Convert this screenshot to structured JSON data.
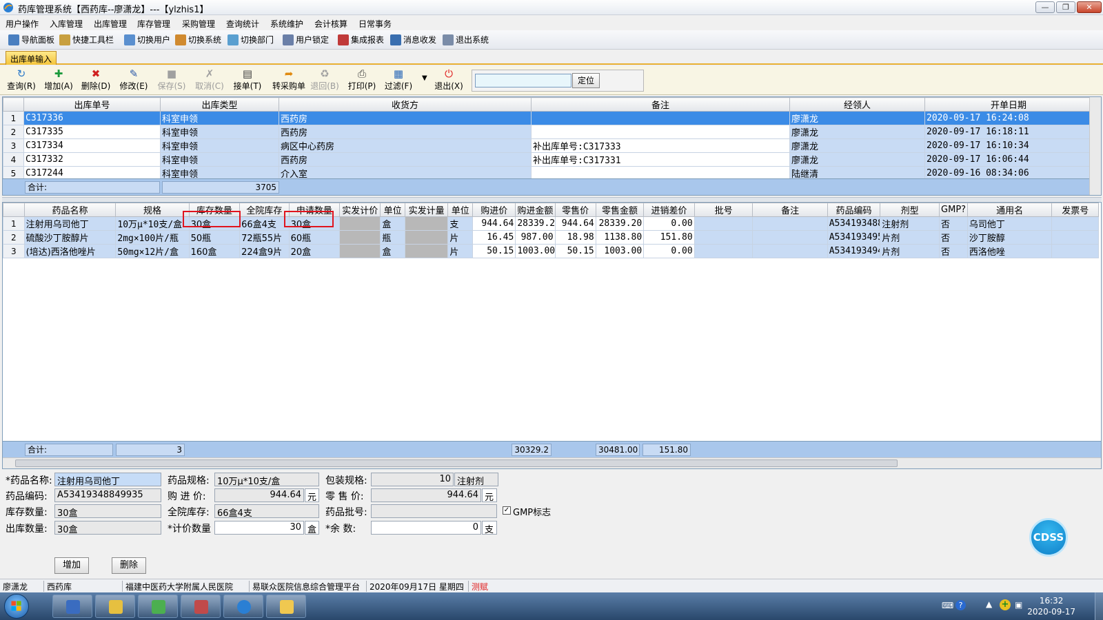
{
  "window": {
    "title": "药库管理系统【西药库--廖潇龙】---【ylzhis1】",
    "minimize": "—",
    "restore": "❐",
    "close": "✕"
  },
  "menu": [
    "用户操作",
    "入库管理",
    "出库管理",
    "库存管理",
    "采购管理",
    "查询统计",
    "系统维护",
    "会计核算",
    "日常事务"
  ],
  "quickbar": [
    {
      "label": "导航面板",
      "icon": "nav-panel-icon",
      "color": "#4a7fc0"
    },
    {
      "label": "快捷工具栏",
      "icon": "tool-icon",
      "color": "#c8a040"
    },
    {
      "label": "切换用户",
      "icon": "users-icon",
      "color": "#5a8fcf"
    },
    {
      "label": "切换系统",
      "icon": "switch-icon",
      "color": "#d08a30"
    },
    {
      "label": "切换部门",
      "icon": "dept-icon",
      "color": "#5a9fd0"
    },
    {
      "label": "用户锁定",
      "icon": "lock-user-icon",
      "color": "#6a7fa8"
    },
    {
      "label": "集成报表",
      "icon": "report-icon",
      "color": "#c03a3a"
    },
    {
      "label": "消息收发",
      "icon": "help-icon",
      "color": "#3a6fb0"
    },
    {
      "label": "退出系统",
      "icon": "exit-icon",
      "color": "#7a8ca8"
    }
  ],
  "tab": "出库单输入",
  "actions": [
    {
      "label": "查询(R)",
      "icon": "query-icon",
      "glyph": "↻",
      "color": "#2a78c8",
      "disabled": false
    },
    {
      "label": "增加(A)",
      "icon": "add-icon",
      "glyph": "✚",
      "color": "#1c9a3c",
      "disabled": false
    },
    {
      "label": "删除(D)",
      "icon": "delete-icon",
      "glyph": "✖",
      "color": "#d02020",
      "disabled": false
    },
    {
      "label": "修改(E)",
      "icon": "edit-icon",
      "glyph": "✎",
      "color": "#2a58a8",
      "disabled": false
    },
    {
      "label": "保存(S)",
      "icon": "save-icon",
      "glyph": "■",
      "color": "#a0a0a0",
      "disabled": true
    },
    {
      "label": "取消(C)",
      "icon": "cancel-icon",
      "glyph": "✗",
      "color": "#a0a0a0",
      "disabled": true
    },
    {
      "label": "接单(T)",
      "icon": "receive-icon",
      "glyph": "▤",
      "color": "#404040",
      "disabled": false
    },
    {
      "label": "转采购单",
      "icon": "transfer-icon",
      "glyph": "➦",
      "color": "#e08a10",
      "disabled": false
    },
    {
      "label": "退回(B)",
      "icon": "return-icon",
      "glyph": "♻",
      "color": "#a0a0a0",
      "disabled": true
    },
    {
      "label": "打印(P)",
      "icon": "print-icon",
      "glyph": "⎙",
      "color": "#404040",
      "disabled": false
    },
    {
      "label": "过滤(F)",
      "icon": "filter-icon",
      "glyph": "▦",
      "color": "#2a68b8",
      "disabled": false
    },
    {
      "label": "退出(X)",
      "icon": "power-icon",
      "glyph": "⏻",
      "color": "#e02020",
      "disabled": false
    }
  ],
  "locate": {
    "value": "",
    "button": "定位"
  },
  "orders": {
    "headers": [
      "出库单号",
      "出库类型",
      "收货方",
      "备注",
      "经领人",
      "开单日期"
    ],
    "rows": [
      {
        "no": "1",
        "cells": [
          "C317336",
          "科室申领",
          "西药房",
          "",
          "廖潇龙",
          "2020-09-17 16:24:08"
        ]
      },
      {
        "no": "2",
        "cells": [
          "C317335",
          "科室申领",
          "西药房",
          "",
          "廖潇龙",
          "2020-09-17 16:18:11"
        ]
      },
      {
        "no": "3",
        "cells": [
          "C317334",
          "科室申领",
          "病区中心药房",
          "补出库单号:C317333",
          "廖潇龙",
          "2020-09-17 16:10:34"
        ]
      },
      {
        "no": "4",
        "cells": [
          "C317332",
          "科室申领",
          "西药房",
          "补出库单号:C317331",
          "廖潇龙",
          "2020-09-17 16:06:44"
        ]
      },
      {
        "no": "5",
        "cells": [
          "C317244",
          "科室申领",
          "介入室",
          "",
          "陆继清",
          "2020-09-16 08:34:06"
        ]
      }
    ],
    "sum_label": "合计:",
    "sum_value": "3705"
  },
  "items": {
    "headers": [
      "药品名称",
      "规格",
      "库存数量",
      "全院库存",
      "申请数量",
      "实发计价",
      "单位",
      "实发计量",
      "单位",
      "购进价",
      "购进金额",
      "零售价",
      "零售金额",
      "进销差价",
      "批号",
      "备注",
      "药品编码",
      "剂型",
      "GMP?",
      "通用名",
      "发票号"
    ],
    "rows": [
      {
        "no": "1",
        "cells": [
          "注射用乌司他丁",
          "10万μ*10支/盒",
          "30盒",
          "66盒4支",
          "30盒",
          "",
          "盒",
          "",
          "支",
          "944.64",
          "28339.20",
          "944.64",
          "28339.20",
          "0.00",
          "",
          "",
          "A534193488",
          "注射剂",
          "否",
          "乌司他丁",
          ""
        ]
      },
      {
        "no": "2",
        "cells": [
          "硫酸沙丁胺醇片",
          "2mg×100片/瓶",
          "50瓶",
          "72瓶55片",
          "60瓶",
          "",
          "瓶",
          "",
          "片",
          "16.45",
          "987.00",
          "18.98",
          "1138.80",
          "151.80",
          "",
          "",
          "A534193495",
          "片剂",
          "否",
          "沙丁胺醇",
          ""
        ]
      },
      {
        "no": "3",
        "cells": [
          "(培达)西洛他唑片",
          "50mg×12片/盒",
          "160盒",
          "224盒9片",
          "20盒",
          "",
          "盒",
          "",
          "片",
          "50.15",
          "1003.00",
          "50.15",
          "1003.00",
          "0.00",
          "",
          "",
          "A534193494",
          "片剂",
          "否",
          "西洛他唑",
          ""
        ]
      }
    ],
    "sum_label": "合计:",
    "sum_count": "3",
    "sum_purchase": "30329.2",
    "sum_retail": "30481.00",
    "sum_diff": "151.80"
  },
  "form": {
    "name_label": "*药品名称:",
    "name": "注射用乌司他丁",
    "spec_label": "药品规格:",
    "spec": "10万μ*10支/盒",
    "pack_label": "包装规格:",
    "pack": "10",
    "pack_unit": "注射剂",
    "code_label": "药品编码:",
    "code": "A53419348849935",
    "buy_label": "购 进 价:",
    "buy": "944.64",
    "buy_unit": "元",
    "retail_label": "零 售 价:",
    "retail": "944.64",
    "retail_unit": "元",
    "stock_label": "库存数量:",
    "stock": "30盒",
    "all_label": "全院库存:",
    "all": "66盒4支",
    "batch_label": "药品批号:",
    "batch": "",
    "gmp_label": "GMP标志",
    "out_label": "出库数量:",
    "out": "30盒",
    "priced_label": "*计价数量",
    "priced": "30",
    "priced_unit": "盒",
    "rest_label": "*余    数:",
    "rest": "0",
    "rest_unit": "支",
    "add_button": "增加",
    "delete_button": "删除"
  },
  "status": [
    "廖潇龙",
    "西药库",
    "福建中医药大学附属人民医院",
    "易联众医院信息综合管理平台",
    "2020年09月17日 星期四",
    "测赋"
  ],
  "cdss": "CDSS",
  "clock": {
    "time": "16:32",
    "date": "2020-09-17"
  }
}
